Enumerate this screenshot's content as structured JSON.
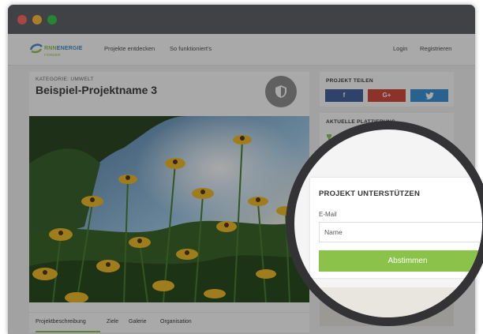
{
  "colors": {
    "accent_green": "#8bc34a",
    "brand_blue": "#3b87c9",
    "facebook": "#3b5998",
    "googleplus": "#d23f31",
    "twitter": "#2f8fd6"
  },
  "logo": {
    "word_a": "RNN",
    "word_b": "ENERGIE",
    "sub": "FÖRDER"
  },
  "nav": {
    "projects_label": "Projekte entdecken",
    "how_label": "So funktioniert's",
    "login_label": "Login",
    "register_label": "Registrieren"
  },
  "project": {
    "category": "KATEGORIE: UMWELT",
    "title": "Beispiel-Projektname 3",
    "badge_icon": "shield-icon"
  },
  "tabs": [
    {
      "label": "Projektbeschreibung"
    },
    {
      "label": "Ziele"
    },
    {
      "label": "Galerie"
    },
    {
      "label": "Organisation"
    }
  ],
  "share": {
    "heading": "PROJEKT TEILEN",
    "facebook": "f",
    "googleplus": "G+",
    "twitter_icon": "twitter-bird-icon"
  },
  "ranking": {
    "heading": "AKTUELLE PLATZIERUNG"
  },
  "support": {
    "heading": "PROJEKT UNTERSTÜTZEN",
    "email_label": "E-Mail",
    "name_placeholder": "Name",
    "submit_label": "Abstimmen"
  }
}
